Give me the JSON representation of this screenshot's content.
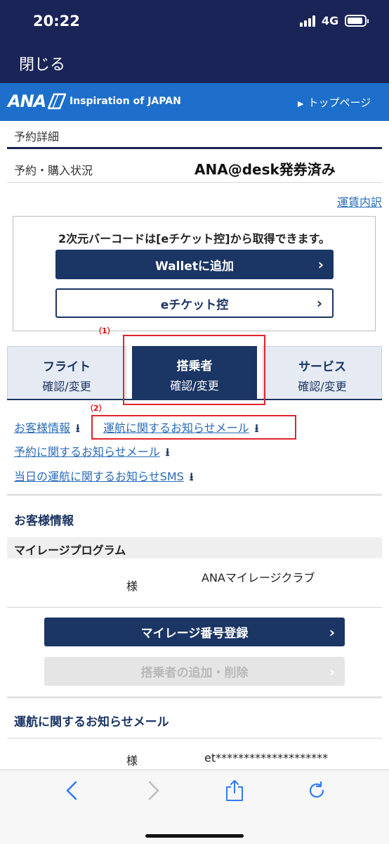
{
  "status_bar": {
    "time": "20:22",
    "network": "4G"
  },
  "header": {
    "close_label": "閉じる"
  },
  "ana_bar": {
    "logo_text": "ANA",
    "tagline": "Inspiration of JAPAN",
    "top_page_label": "トップページ"
  },
  "reservation": {
    "section_title": "予約詳細",
    "status_label": "予約・購入状況",
    "status_value": "ANA@desk発券済み",
    "fare_link": "運賃内訳"
  },
  "barcode": {
    "note": "2次元バーコードは[eチケット控]から取得できます。",
    "wallet_button": "Walletに追加",
    "eticket_button": "eチケット控"
  },
  "annotations": {
    "mark1": "（1）",
    "mark2": "（2）"
  },
  "tabs": [
    {
      "line1": "フライト",
      "line2": "確認/変更"
    },
    {
      "line1": "搭乗者",
      "line2": "確認/変更"
    },
    {
      "line1": "サービス",
      "line2": "確認/変更"
    }
  ],
  "links": {
    "customer_info": "お客様情報",
    "flight_mail": "運航に関するお知らせメール",
    "reservation_mail": "予約に関するお知らせメール",
    "sms": "当日の運航に関するお知らせSMS"
  },
  "customer_section": {
    "title": "お客様情報",
    "mileage_program": "マイレージプログラム",
    "sama": "様",
    "club": "ANAマイレージクラブ",
    "mileage_button": "マイレージ番号登録",
    "add_remove_button": "搭乗者の追加・削除"
  },
  "mail_section": {
    "title": "運航に関するお知らせメール",
    "sama": "様",
    "email_masked": "et********************"
  },
  "colors": {
    "navy": "#1b2457",
    "ana_blue": "#1d6fcb",
    "link": "#2a6bb7",
    "annotation_red": "#e0242b"
  }
}
